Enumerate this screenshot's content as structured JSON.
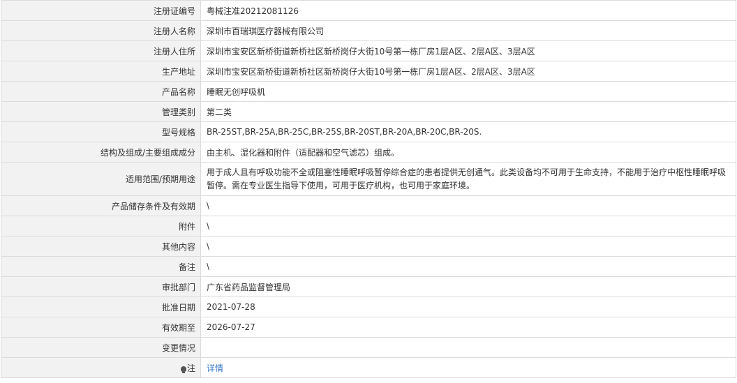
{
  "rows": [
    {
      "label": "注册证编号",
      "value": "粤械注准20212081126"
    },
    {
      "label": "注册人名称",
      "value": "深圳市百瑞琪医疗器械有限公司"
    },
    {
      "label": "注册人住所",
      "value": "深圳市宝安区新桥街道新桥社区新桥岗仔大街10号第一栋厂房1层A区、2层A区、3层A区"
    },
    {
      "label": "生产地址",
      "value": "深圳市宝安区新桥街道新桥社区新桥岗仔大街10号第一栋厂房1层A区、2层A区、3层A区"
    },
    {
      "label": "产品名称",
      "value": "睡眠无创呼吸机"
    },
    {
      "label": "管理类别",
      "value": "第二类"
    },
    {
      "label": "型号规格",
      "value": "BR-25ST,BR-25A,BR-25C,BR-25S,BR-20ST,BR-20A,BR-20C,BR-20S."
    },
    {
      "label": "结构及组成/主要组成成分",
      "value": "由主机、湿化器和附件（适配器和空气滤芯）组成。"
    },
    {
      "label": "适用范围/预期用途",
      "value": "用于成人且有呼吸功能不全或阻塞性睡眠呼吸暂停综合症的患者提供无创通气。此类设备均不可用于生命支持，不能用于治疗中枢性睡眠呼吸暂停。需在专业医生指导下使用，可用于医疗机构，也可用于家庭环境。"
    },
    {
      "label": "产品储存条件及有效期",
      "value": "\\"
    },
    {
      "label": "附件",
      "value": "\\"
    },
    {
      "label": "其他内容",
      "value": "\\"
    },
    {
      "label": "备注",
      "value": "\\"
    },
    {
      "label": "审批部门",
      "value": "广东省药品监督管理局"
    },
    {
      "label": "批准日期",
      "value": "2021-07-28"
    },
    {
      "label": "有效期至",
      "value": "2026-07-27"
    },
    {
      "label": "变更情况",
      "value": ""
    }
  ],
  "note_row": {
    "label": "注",
    "icon": "lightbulb-icon",
    "link_text": "详情"
  }
}
